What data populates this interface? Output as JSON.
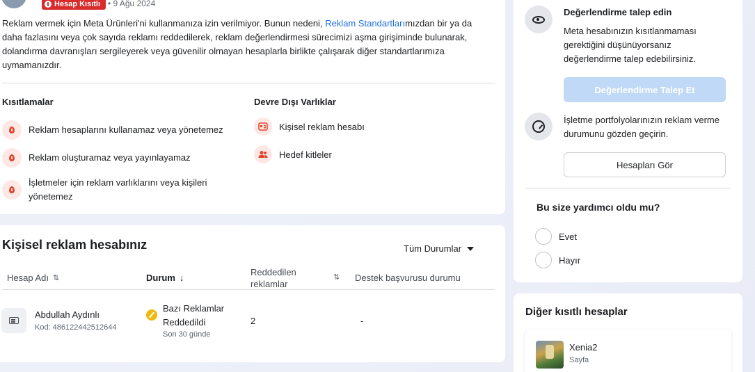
{
  "header": {
    "badge_label": "Hesap Kısıtlı",
    "date": "• 9 Ağu 2024"
  },
  "description": {
    "before_link": "Reklam vermek için Meta Ürünleri'ni kullanmanıza izin verilmiyor. Bunun nedeni, ",
    "link_text": "Reklam Standartları",
    "after_link": "mızdan bir ya da daha fazlasını veya çok sayıda reklamı reddedilerek, reklam değerlendirmesi sürecimizi aşma girişiminde bulunarak, dolandırma davranışları sergileyerek veya güvenilir olmayan hesaplarla birlikte çalışarak diğer standartlarımıza uymamanızdır."
  },
  "restrictions": {
    "title": "Kısıtlamalar",
    "items": [
      "Reklam hesaplarını kullanamaz veya yönetemez",
      "Reklam oluşturamaz veya yayınlayamaz",
      "İşletmeler için reklam varlıklarını veya kişileri yönetemez"
    ]
  },
  "disabled_assets": {
    "title": "Devre Dışı Varlıklar",
    "items": [
      {
        "label": "Kişisel reklam hesabı",
        "icon": "ad-account-icon"
      },
      {
        "label": "Hedef kitleler",
        "icon": "people-icon"
      }
    ]
  },
  "accounts_section": {
    "title": "Kişisel reklam hesabınız",
    "filter_label": "Tüm Durumlar",
    "columns": [
      "Hesap Adı",
      "Durum",
      "Reddedilen reklamlar",
      "Destek başvurusu durumu"
    ],
    "rows": [
      {
        "name": "Abdullah Aydınlı",
        "id": "Kod: 486122442512644",
        "status": "Bazı Reklamlar Reddedildi",
        "status_sub": "Son 30 günde",
        "rejected": "2",
        "support": "-"
      }
    ]
  },
  "review": {
    "title": "Değerlendirme talep edin",
    "text": "Meta hesabınızın kısıtlanmaması gerektiğini düşünüyorsanız değerlendirme talep edebilirsiniz.",
    "button": "Değerlendirme Talep Et",
    "portfolio_text": "İşletme portfolyolarınızın reklam verme durumunu gözden geçirin.",
    "portfolio_button": "Hesapları Gör",
    "help_title": "Bu size yardımcı oldu mu?",
    "yes": "Evet",
    "no": "Hayır"
  },
  "other_accounts": {
    "title": "Diğer kısıtlı hesaplar",
    "items": [
      {
        "name": "Xenia2",
        "type": "Sayfa"
      }
    ]
  },
  "colors": {
    "badge": "#d92b2b",
    "link": "#216fdb",
    "primary_disabled": "#bfd9f6",
    "warning": "#f0b90b"
  }
}
